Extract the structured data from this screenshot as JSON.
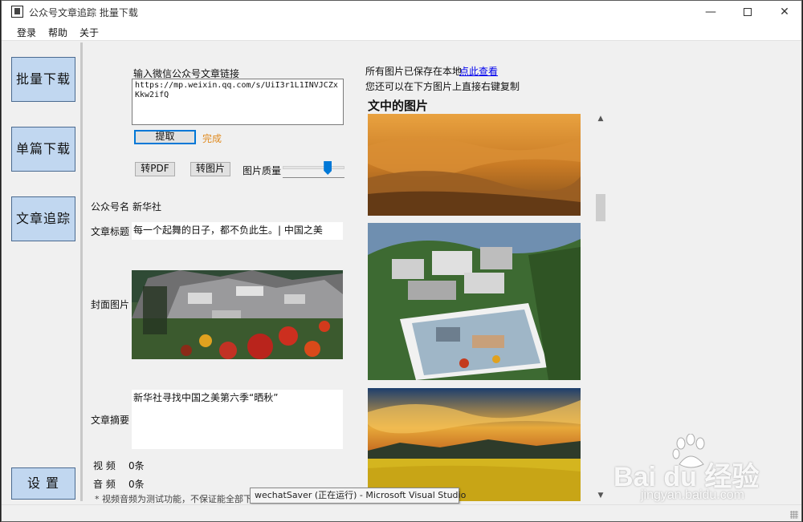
{
  "window": {
    "title": "公众号文章追踪 批量下载"
  },
  "menu": [
    "登录",
    "帮助",
    "关于"
  ],
  "nav": {
    "batch_download": "批量下载",
    "single_download": "单篇下载",
    "article_tracking": "文章追踪",
    "settings": "设 置"
  },
  "form": {
    "url_label": "输入微信公众号文章链接",
    "url_value": "https://mp.weixin.qq.com/s/UiI3r1L1INVJCZxKkw2ifQ",
    "extract_button": "提取",
    "status": "完成",
    "to_pdf_button": "转PDF",
    "to_image_button": "转图片",
    "quality_label": "图片质量",
    "quality_level": 0.73
  },
  "article": {
    "account_label": "公众号名",
    "account_value": "新华社",
    "title_label": "文章标题",
    "title_value": "每一个起舞的日子，都不负此生。| 中国之美",
    "cover_label": "封面图片",
    "summary_label": "文章摘要",
    "summary_value": "新华社寻找中国之美第六季“晒秋”",
    "video_label": "视 频",
    "video_value": "0条",
    "audio_label": "音 频",
    "audio_value": "0条",
    "note": "* 视频音频为测试功能，不保证能全部下"
  },
  "images_panel": {
    "saved_text": "所有图片已保存在本地",
    "view_link": "点此查看",
    "hint_text": "您还可以在下方图片上直接右键复制",
    "section_title": "文中的图片"
  },
  "tooltip": "wechatSaver (正在运行) - Microsoft Visual Studio",
  "watermark": {
    "brand": "Bai du 经验",
    "url": "jingyan.baidu.com"
  },
  "colors": {
    "nav_button": "#c1d7f0",
    "status_done": "#e08a1e",
    "accent": "#0078d7",
    "link": "#0000ee"
  }
}
